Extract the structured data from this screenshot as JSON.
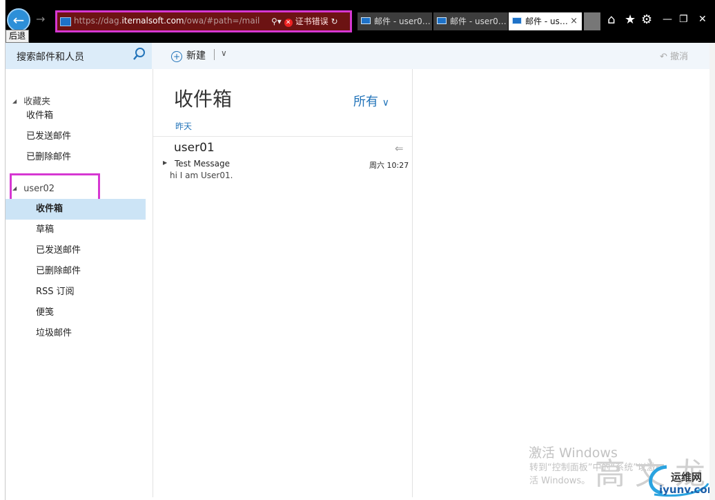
{
  "browser": {
    "back_tooltip": "后退",
    "url_prefix": "https://dag.",
    "url_domain": "iternalsoft.com",
    "url_suffix": "/owa/#path=/mail",
    "cert_error": "证书错误",
    "tabs": [
      {
        "label": "邮件 - user0…",
        "active": false
      },
      {
        "label": "邮件 - user0…",
        "active": false
      },
      {
        "label": "邮件 - us…",
        "active": true
      }
    ],
    "close_tab": "×"
  },
  "header": {
    "search_placeholder": "搜索邮件和人员",
    "new_label": "新建",
    "undo_label": "撤消"
  },
  "nav": {
    "favorites_label": "收藏夹",
    "favorites": [
      "收件箱",
      "已发送邮件",
      "已删除邮件"
    ],
    "account_label": "user02",
    "folders": [
      "收件箱",
      "草稿",
      "已发送邮件",
      "已删除邮件",
      "RSS 订阅",
      "便笺",
      "垃圾邮件"
    ],
    "selected_index": 0
  },
  "list": {
    "folder_title": "收件箱",
    "filter_label": "所有",
    "group_label": "昨天",
    "messages": [
      {
        "from": "user01",
        "subject": "Test Message",
        "time": "周六 10:27",
        "preview": "hi I am User01."
      }
    ]
  },
  "watermark": {
    "activate_title": "激活 Windows",
    "activate_sub": "转到“控制面板”中的“系统”以激活 Windows。",
    "hanzi": "高文龙",
    "site_name": "运维网",
    "site_url": "iyunv.com"
  },
  "colors": {
    "accent": "#2173b9",
    "selection": "#cce4f6",
    "highlight_annotation": "#d637d2"
  }
}
